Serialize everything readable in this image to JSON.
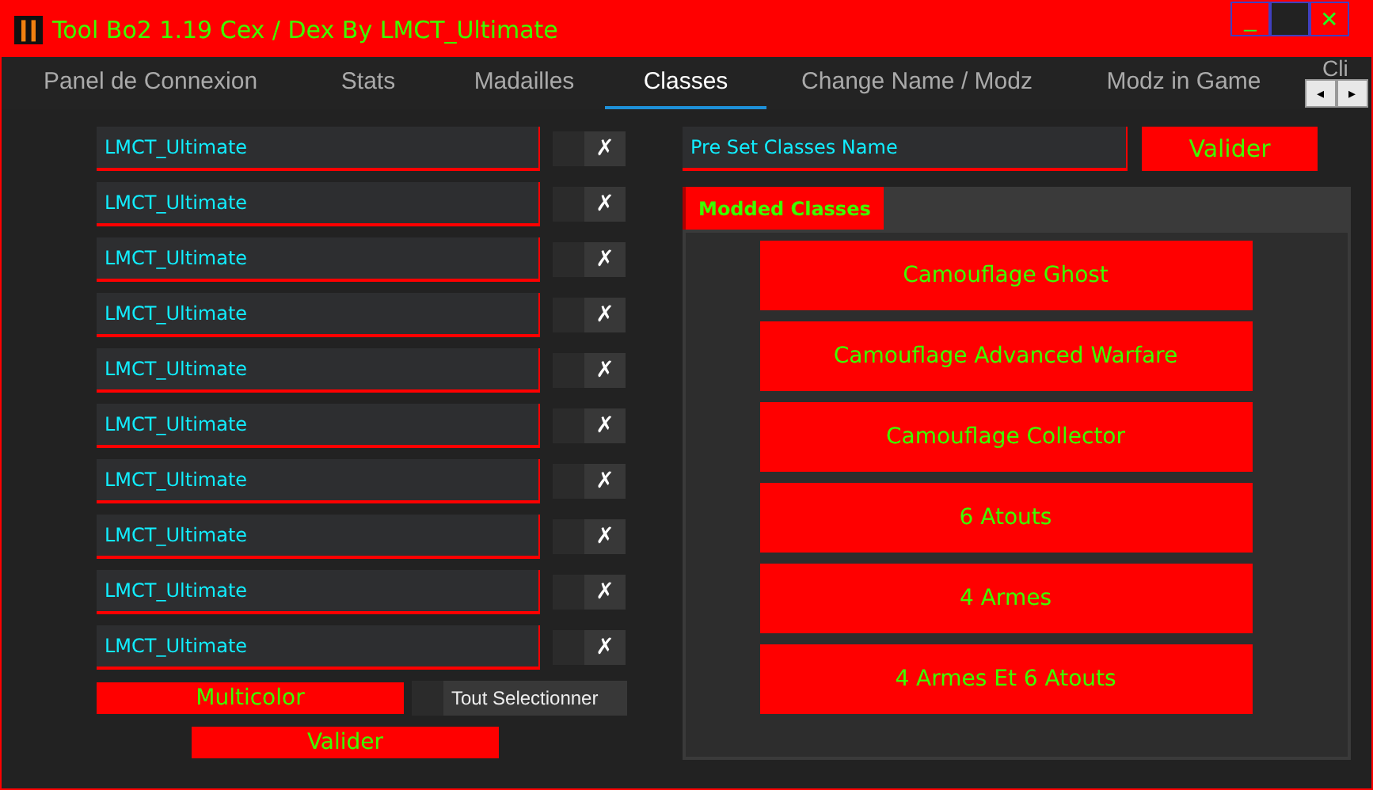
{
  "window": {
    "title": "Tool Bo2 1.19 Cex / Dex By LMCT_Ultimate",
    "controls": [
      "_",
      "✕"
    ]
  },
  "tabs": [
    {
      "label": "Panel de Connexion",
      "selected": false
    },
    {
      "label": "Stats",
      "selected": false
    },
    {
      "label": "Madailles",
      "selected": false
    },
    {
      "label": "Classes",
      "selected": true
    },
    {
      "label": "Change Name / Modz",
      "selected": false
    },
    {
      "label": "Modz in Game",
      "selected": false
    },
    {
      "label": "Cli",
      "selected": false
    }
  ],
  "tab_scroll": [
    "◂",
    "▸"
  ],
  "class_names": [
    {
      "value": "LMCT_Ultimate",
      "checked": false,
      "mark": "✗"
    },
    {
      "value": "LMCT_Ultimate",
      "checked": false,
      "mark": "✗"
    },
    {
      "value": "LMCT_Ultimate",
      "checked": false,
      "mark": "✗"
    },
    {
      "value": "LMCT_Ultimate",
      "checked": false,
      "mark": "✗"
    },
    {
      "value": "LMCT_Ultimate",
      "checked": false,
      "mark": "✗"
    },
    {
      "value": "LMCT_Ultimate",
      "checked": false,
      "mark": "✗"
    },
    {
      "value": "LMCT_Ultimate",
      "checked": false,
      "mark": "✗"
    },
    {
      "value": "LMCT_Ultimate",
      "checked": false,
      "mark": "✗"
    },
    {
      "value": "LMCT_Ultimate",
      "checked": false,
      "mark": "✗"
    },
    {
      "value": "LMCT_Ultimate",
      "checked": false,
      "mark": "✗"
    }
  ],
  "multicolor_button": "Multicolor",
  "select_all": {
    "label": "Tout Selectionner",
    "checked": false
  },
  "left_submit": "Valider",
  "preset": {
    "value": "Pre Set Classes Name",
    "button": "Valider"
  },
  "inner_tabs": [
    {
      "label": "Modded Classes",
      "selected": true
    }
  ],
  "modded_buttons": [
    "Camouflage Ghost",
    "Camouflage Advanced Warfare",
    "Camouflage Collector",
    "6 Atouts",
    "4 Armes",
    "4 Armes Et 6 Atouts"
  ]
}
